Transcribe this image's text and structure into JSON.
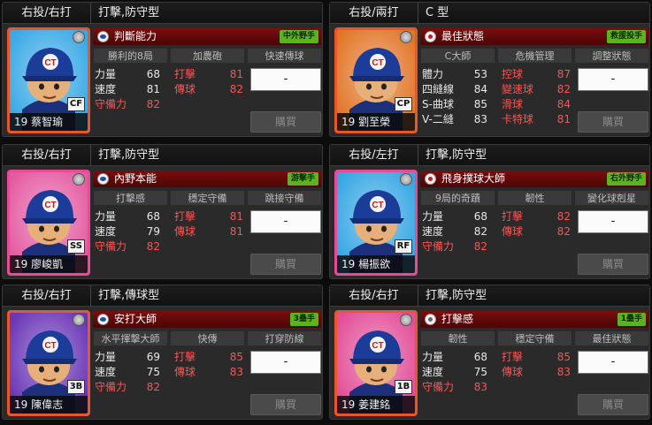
{
  "ui": {
    "buy_label": "購買",
    "dropdown_value": "-"
  },
  "cards": [
    {
      "handed": "右投/右打",
      "type": "打擊,防守型",
      "skill": {
        "name": "判斷能力",
        "icon": "blue",
        "badge": "中外野手"
      },
      "skills": [
        "勝利的8局",
        "加農砲",
        "快速傳球"
      ],
      "stats": [
        {
          "label": "力量",
          "value": "68"
        },
        {
          "label": "打擊",
          "value": "81"
        },
        {
          "label": "速度",
          "value": "81"
        },
        {
          "label": "傳球",
          "value": "82"
        },
        {
          "label": "守備力",
          "value": "82"
        }
      ],
      "number": "19",
      "name": "蔡智瑜",
      "position": "CF",
      "frame_color": "#e8562a",
      "bg_color": "#39a9e6"
    },
    {
      "handed": "右投/兩打",
      "type": "C 型",
      "skill": {
        "name": "最佳狀態",
        "icon": "red",
        "badge": "救援投手"
      },
      "skills": [
        "C大師",
        "危機管理",
        "調整狀態"
      ],
      "stats": [
        {
          "label": "體力",
          "value": "53"
        },
        {
          "label": "控球",
          "value": "87"
        },
        {
          "label": "四縫線",
          "value": "84"
        },
        {
          "label": "變速球",
          "value": "82"
        },
        {
          "label": "S-曲球",
          "value": "85"
        },
        {
          "label": "滑球",
          "value": "84"
        },
        {
          "label": "V-二縫",
          "value": "83"
        },
        {
          "label": "卡特球",
          "value": "81"
        }
      ],
      "number": "19",
      "name": "劉至榮",
      "position": "CP",
      "frame_color": "#e8562a",
      "bg_color": "#e27628"
    },
    {
      "handed": "右投/右打",
      "type": "打擊,防守型",
      "skill": {
        "name": "內野本能",
        "icon": "blue",
        "badge": "游擊手"
      },
      "skills": [
        "打擊感",
        "穩定守備",
        "跳接守備"
      ],
      "stats": [
        {
          "label": "力量",
          "value": "68"
        },
        {
          "label": "打擊",
          "value": "81"
        },
        {
          "label": "速度",
          "value": "79"
        },
        {
          "label": "傳球",
          "value": "81"
        },
        {
          "label": "守備力",
          "value": "82"
        }
      ],
      "number": "19",
      "name": "廖峻凱",
      "position": "SS",
      "frame_color": "#ea4a97",
      "bg_color": "#e45ba2"
    },
    {
      "handed": "右投/左打",
      "type": "打擊,防守型",
      "skill": {
        "name": "飛身撲球大師",
        "icon": "red",
        "badge": "右外野手"
      },
      "skills": [
        "9局的奇蹟",
        "韌性",
        "變化球剋星"
      ],
      "stats": [
        {
          "label": "力量",
          "value": "68"
        },
        {
          "label": "打擊",
          "value": "82"
        },
        {
          "label": "速度",
          "value": "82"
        },
        {
          "label": "傳球",
          "value": "82"
        },
        {
          "label": "守備力",
          "value": "82"
        }
      ],
      "number": "19",
      "name": "楊振欲",
      "position": "RF",
      "frame_color": "#e94a97",
      "bg_color": "#36a7e4"
    },
    {
      "handed": "右投/右打",
      "type": "打擊,傳球型",
      "skill": {
        "name": "安打大師",
        "icon": "blue",
        "badge": "3壘手"
      },
      "skills": [
        "水平揮擊大師",
        "快傳",
        "打穿防線"
      ],
      "stats": [
        {
          "label": "力量",
          "value": "69"
        },
        {
          "label": "打擊",
          "value": "85"
        },
        {
          "label": "速度",
          "value": "75"
        },
        {
          "label": "傳球",
          "value": "83"
        },
        {
          "label": "守備力",
          "value": "82"
        }
      ],
      "number": "19",
      "name": "陳偉志",
      "position": "3B",
      "frame_color": "#e9562a",
      "bg_color": "#6a36b7"
    },
    {
      "handed": "右投/右打",
      "type": "打擊,防守型",
      "skill": {
        "name": "打擊感",
        "icon": "gray",
        "badge": "1壘手"
      },
      "skills": [
        "韌性",
        "穩定守備",
        "最佳狀態"
      ],
      "stats": [
        {
          "label": "力量",
          "value": "68"
        },
        {
          "label": "打擊",
          "value": "85"
        },
        {
          "label": "速度",
          "value": "75"
        },
        {
          "label": "傳球",
          "value": "83"
        },
        {
          "label": "守備力",
          "value": "83"
        }
      ],
      "number": "19",
      "name": "姜建銘",
      "position": "1B",
      "frame_color": "#e9562a",
      "bg_color": "#e34e98"
    }
  ]
}
